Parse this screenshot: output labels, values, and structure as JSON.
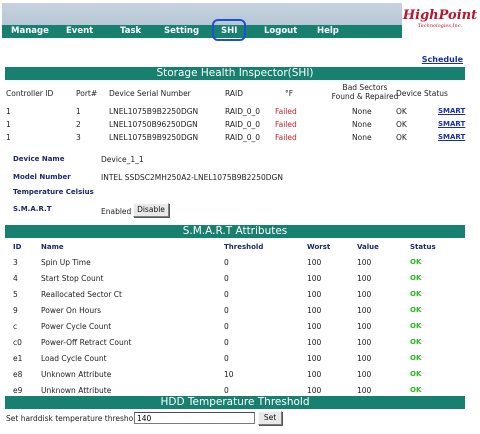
{
  "nav": {
    "items": [
      "Manage",
      "Event",
      "Task",
      "Setting",
      "SHI",
      "Logout",
      "Help"
    ],
    "logo_main": "HighPoint",
    "logo_sub": "Technologies,Inc."
  },
  "schedule_link": "Schedule",
  "shi": {
    "title": "Storage Health Inspector(SHI)",
    "headers": {
      "controller": "Controller ID",
      "port": "Port#",
      "serial": "Device Serial Number",
      "raid": "RAID",
      "temp": "°F",
      "bad_sectors_1": "Bad Sectors",
      "bad_sectors_2": "Found & Repaired",
      "status": "Device Status"
    },
    "rows": [
      {
        "controller": "1",
        "port": "1",
        "serial": "LNEL1075B9B2250DGN",
        "raid": "RAID_0_0",
        "temp": "Failed",
        "bad_sectors": "None",
        "status": "OK",
        "link": "SMART"
      },
      {
        "controller": "1",
        "port": "2",
        "serial": "LNEL10750B96250DGN",
        "raid": "RAID_0_0",
        "temp": "Failed",
        "bad_sectors": "None",
        "status": "OK",
        "link": "SMART"
      },
      {
        "controller": "1",
        "port": "3",
        "serial": "LNEL1075B9B9250DGN",
        "raid": "RAID_0_0",
        "temp": "Failed",
        "bad_sectors": "None",
        "status": "OK",
        "link": "SMART"
      }
    ]
  },
  "device": {
    "name_label": "Device Name",
    "name_value": "Device_1_1",
    "model_label": "Model Number",
    "model_value": "INTEL SSDSC2MH250A2-LNEL1075B9B2250DGN",
    "temp_label": "Temperature Celsius",
    "smart_label": "S.M.A.R.T",
    "smart_value": "Enabled",
    "disable_button": "Disable"
  },
  "smart": {
    "title": "S.M.A.R.T Attributes",
    "headers": {
      "id": "ID",
      "name": "Name",
      "threshold": "Threshold",
      "worst": "Worst",
      "value": "Value",
      "status": "Status"
    },
    "rows": [
      {
        "id": "3",
        "name": "Spin Up Time",
        "threshold": "0",
        "worst": "100",
        "value": "100",
        "status": "OK"
      },
      {
        "id": "4",
        "name": "Start Stop Count",
        "threshold": "0",
        "worst": "100",
        "value": "100",
        "status": "OK"
      },
      {
        "id": "5",
        "name": "Reallocated Sector Ct",
        "threshold": "0",
        "worst": "100",
        "value": "100",
        "status": "OK"
      },
      {
        "id": "9",
        "name": "Power On Hours",
        "threshold": "0",
        "worst": "100",
        "value": "100",
        "status": "OK"
      },
      {
        "id": "c",
        "name": "Power Cycle Count",
        "threshold": "0",
        "worst": "100",
        "value": "100",
        "status": "OK"
      },
      {
        "id": "c0",
        "name": "Power-Off Retract Count",
        "threshold": "0",
        "worst": "100",
        "value": "100",
        "status": "OK"
      },
      {
        "id": "e1",
        "name": "Load Cycle Count",
        "threshold": "0",
        "worst": "100",
        "value": "100",
        "status": "OK"
      },
      {
        "id": "e8",
        "name": "Unknown Attribute",
        "threshold": "10",
        "worst": "100",
        "value": "100",
        "status": "OK"
      },
      {
        "id": "e9",
        "name": "Unknown Attribute",
        "threshold": "0",
        "worst": "100",
        "value": "100",
        "status": "OK"
      }
    ]
  },
  "threshold": {
    "title": "HDD Temperature Threshold",
    "label": "Set harddisk temperature threshold (F):",
    "value": "140",
    "set_button": "Set"
  },
  "colors": {
    "header_bg": "#17806f",
    "failed": "#c0272d",
    "ok": "#2cb51f",
    "link": "#1a2fa4",
    "label": "#1b2a6b",
    "logo": "#b5162d",
    "shi_highlight": "#1f4fd3"
  }
}
